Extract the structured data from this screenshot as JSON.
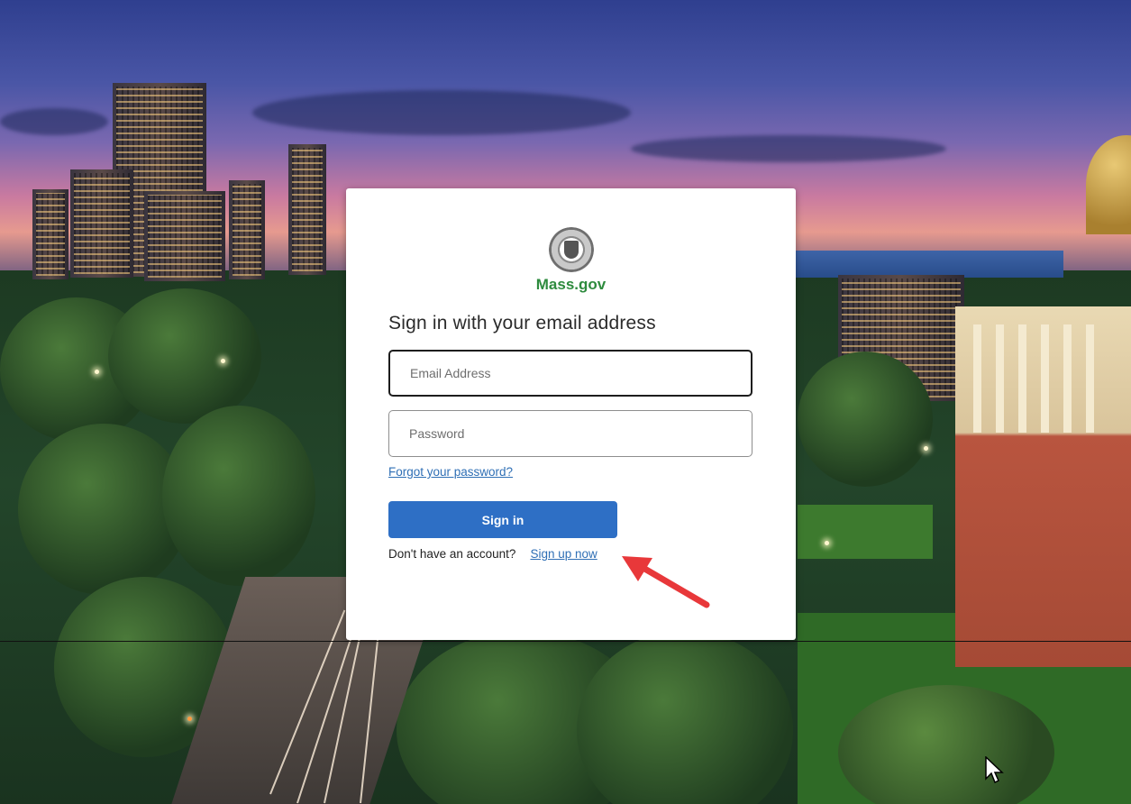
{
  "brand": {
    "name": "Mass.gov",
    "seal_icon": "commonwealth-seal-icon",
    "color": "#2e8b3e"
  },
  "signin": {
    "title": "Sign in with your email address",
    "email_placeholder": "Email Address",
    "email_value": "",
    "password_placeholder": "Password",
    "password_value": "",
    "forgot_link": "Forgot your password?",
    "submit_label": "Sign in",
    "no_account_text": "Don't have an account?",
    "signup_link": "Sign up now"
  },
  "colors": {
    "primary_button": "#2e6fc5",
    "link": "#2f6fb5",
    "annotation_arrow": "#e8383a"
  },
  "annotation": {
    "icon": "red-arrow-icon",
    "points_to": "signup-link"
  }
}
